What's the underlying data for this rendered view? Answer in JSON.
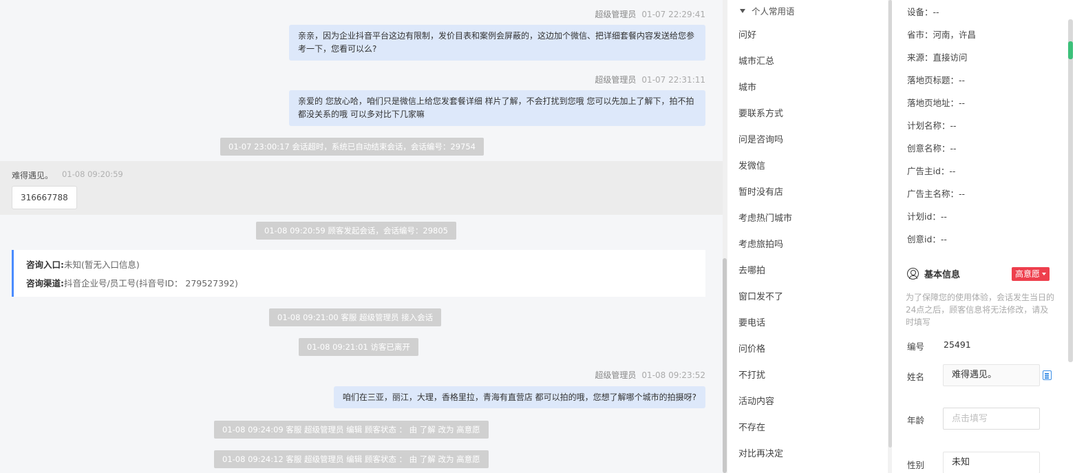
{
  "chat": {
    "messages": [
      {
        "sender": "超级管理员",
        "time": "01-07 22:29:41",
        "text": "亲亲，因为企业抖音平台这边有限制，发价目表和案例会屏蔽的，这边加个微信、把详细套餐内容发送给您参考一下，您看可以么?"
      },
      {
        "sender": "超级管理员",
        "time": "01-07 22:31:11",
        "text": "亲爱的 您放心哈，咱们只是微信上给您发套餐详细 样片了解，不会打扰到您哦 您可以先加上了解下，拍不拍都没关系的哦 可以多对比下几家嘛"
      },
      {
        "sender": "超级管理员",
        "time": "01-08 09:23:52",
        "text": "咱们在三亚，丽江，大理，香格里拉，青海有直营店 都可以拍的哦，您想了解哪个城市的拍摄呀?"
      }
    ],
    "system": [
      "01-07 23:00:17 会话超时，系统已自动结束会话，会话编号：29754",
      "01-08 09:20:59 顾客发起会话，会话编号：29805",
      "01-08 09:21:00 客服 超级管理员 接入会话",
      "01-08 09:21:01 访客已离开",
      "01-08 09:24:09 客服 超级管理员 编辑 顾客状态 ： 由 了解 改为 高意愿",
      "01-08 09:24:12 客服 超级管理员 编辑 顾客状态 ： 由 了解 改为 高意愿"
    ],
    "visitor": {
      "name": "难得遇见。",
      "time": "01-08 09:20:59",
      "text": "316667788"
    },
    "info_card": {
      "entry_label": "咨询入口:",
      "entry_value": "未知(暂无入口信息)",
      "channel_label": "咨询渠道:",
      "channel_value": "抖音企业号/员工号(抖音号ID： 279527392)"
    }
  },
  "phrases": {
    "header": "个人常用语",
    "items": [
      "问好",
      "城市汇总",
      "城市",
      "要联系方式",
      "问是咨询吗",
      "发微信",
      "暂时没有店",
      "考虑热门城市",
      "考虑旅拍吗",
      "去哪拍",
      "窗口发不了",
      "要电话",
      "问价格",
      "不打扰",
      "活动内容",
      "不存在",
      "对比再决定"
    ]
  },
  "customer": {
    "fields": [
      "设备：--",
      "省市：河南，许昌",
      "来源：直接访问",
      "落地页标题：--",
      "落地页地址：--",
      "计划名称：--",
      "创意名称：--",
      "广告主id：--",
      "广告主名称：--",
      "计划id：--",
      "创意id：--"
    ],
    "basic_info_title": "基本信息",
    "intent_badge": "高意愿",
    "notice": "为了保障您的使用体验，会话发生当日的24点之后，顾客信息将无法修改，请及时填写",
    "id_label": "编号",
    "id_value": "25491",
    "name_label": "姓名",
    "name_value": "难得遇见。",
    "age_label": "年龄",
    "age_placeholder": "点击填写",
    "gender_label": "性别",
    "gender_value": "未知"
  }
}
